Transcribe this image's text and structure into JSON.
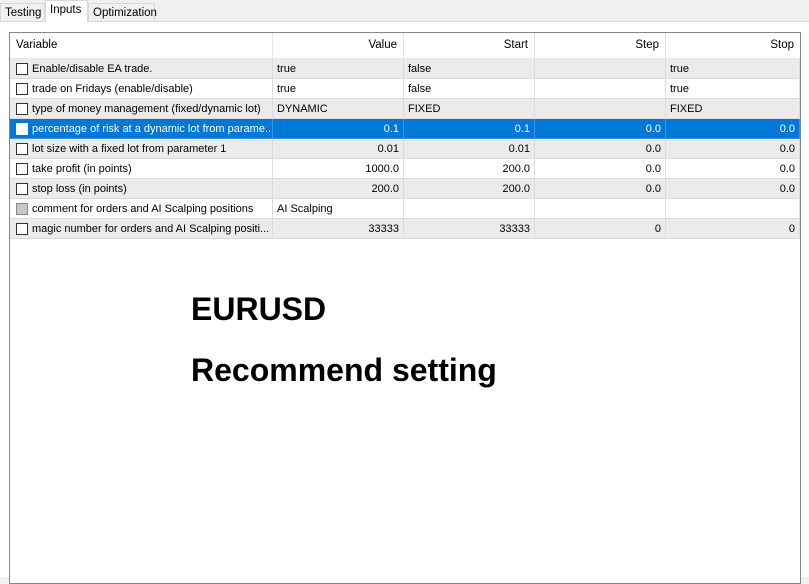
{
  "tabs": [
    "Testing",
    "Inputs",
    "Optimization"
  ],
  "columns": [
    "Variable",
    "Value",
    "Start",
    "Step",
    "Stop"
  ],
  "rows": [
    {
      "var": "Enable/disable EA trade.",
      "value": "true",
      "start": "false",
      "step": "",
      "stop": "true",
      "checked": false
    },
    {
      "var": "trade on Fridays (enable/disable)",
      "value": "true",
      "start": "false",
      "step": "",
      "stop": "true",
      "checked": false
    },
    {
      "var": "type of money management (fixed/dynamic lot)",
      "value": "DYNAMIC",
      "start": "FIXED",
      "step": "",
      "stop": "FIXED",
      "checked": false
    },
    {
      "var": "percentage of risk at a dynamic lot from parame...",
      "value": "0.1",
      "start": "0.1",
      "step": "0.0",
      "stop": "0.0",
      "checked": false
    },
    {
      "var": "lot size with a fixed lot from parameter 1",
      "value": "0.01",
      "start": "0.01",
      "step": "0.0",
      "stop": "0.0",
      "checked": false
    },
    {
      "var": "take profit (in points)",
      "value": "1000.0",
      "start": "200.0",
      "step": "0.0",
      "stop": "0.0",
      "checked": false
    },
    {
      "var": "stop loss (in points)",
      "value": "200.0",
      "start": "200.0",
      "step": "0.0",
      "stop": "0.0",
      "checked": false
    },
    {
      "var": "comment for orders and AI Scalping positions",
      "value": "AI Scalping",
      "start": "",
      "step": "",
      "stop": "",
      "checked": false
    },
    {
      "var": "magic number for orders and AI Scalping positi...",
      "value": "33333",
      "start": "33333",
      "step": "0",
      "stop": "0",
      "checked": false
    }
  ],
  "overlay": {
    "line1": "EURUSD",
    "line2": "Recommend setting"
  },
  "colors": {
    "selection": "#0078d7",
    "alt_row": "#ebebeb"
  }
}
